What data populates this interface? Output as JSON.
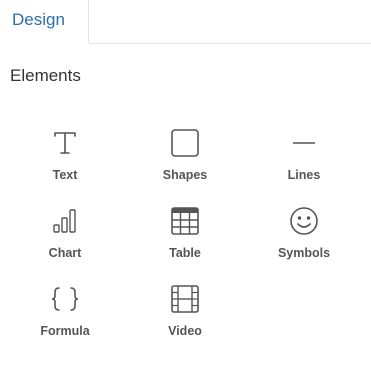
{
  "tabs": {
    "active_label": "Design"
  },
  "section": {
    "title": "Elements"
  },
  "elements": [
    {
      "label": "Text",
      "icon": "text-icon"
    },
    {
      "label": "Shapes",
      "icon": "square-icon"
    },
    {
      "label": "Lines",
      "icon": "line-icon"
    },
    {
      "label": "Chart",
      "icon": "bar-chart-icon"
    },
    {
      "label": "Table",
      "icon": "table-icon"
    },
    {
      "label": "Symbols",
      "icon": "smiley-icon"
    },
    {
      "label": "Formula",
      "icon": "braces-icon"
    },
    {
      "label": "Video",
      "icon": "film-icon"
    }
  ],
  "colors": {
    "tab_active_text": "#2a6fb0",
    "icon_stroke": "#555555"
  }
}
